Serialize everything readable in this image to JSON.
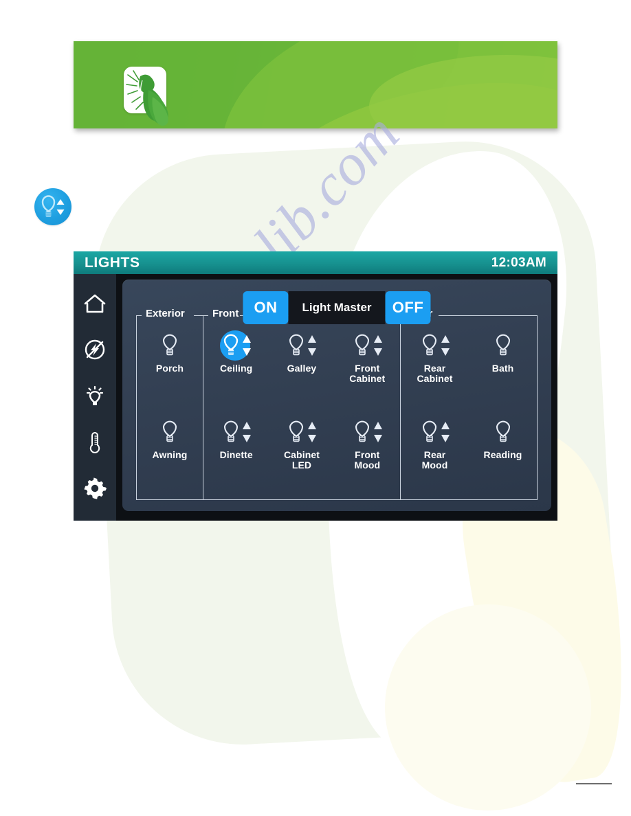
{
  "document": {
    "watermark": "manualslib.com"
  },
  "banner": {
    "logo_icon": "grasshopper-logo-icon",
    "accent_green": "#8cc63f",
    "accent_green_dark": "#4fa832"
  },
  "section_badge": {
    "icon": "dimmable-light-bulb-icon",
    "color": "#1f9fe0"
  },
  "device": {
    "titlebar": {
      "title": "LIGHTS",
      "clock": "12:03AM",
      "color": "#17918f"
    },
    "sidebar": {
      "items": [
        {
          "icon": "home-icon",
          "name": "sidebar-item-home"
        },
        {
          "icon": "power-off-icon",
          "name": "sidebar-item-power"
        },
        {
          "icon": "light-bulb-icon",
          "name": "sidebar-item-lights"
        },
        {
          "icon": "thermometer-icon",
          "name": "sidebar-item-climate"
        },
        {
          "icon": "gear-icon",
          "name": "sidebar-item-settings"
        }
      ]
    },
    "master": {
      "on_label": "ON",
      "label": "Light Master",
      "off_label": "OFF",
      "button_color": "#1b9ef2"
    },
    "groups": [
      {
        "legend": "Exterior",
        "rows": [
          [
            {
              "label": "Porch",
              "dimmable": false,
              "active": false
            }
          ],
          [
            {
              "label": "Awning",
              "dimmable": false,
              "active": false
            }
          ]
        ]
      },
      {
        "legend": "Front",
        "rows": [
          [
            {
              "label": "Ceiling",
              "dimmable": true,
              "active": true
            },
            {
              "label": "Galley",
              "dimmable": true,
              "active": false
            },
            {
              "label": "Front\nCabinet",
              "dimmable": true,
              "active": false
            }
          ],
          [
            {
              "label": "Dinette",
              "dimmable": true,
              "active": false
            },
            {
              "label": "Cabinet\nLED",
              "dimmable": true,
              "active": false
            },
            {
              "label": "Front\nMood",
              "dimmable": true,
              "active": false
            }
          ]
        ]
      },
      {
        "legend": "Rear",
        "rows": [
          [
            {
              "label": "Rear\nCabinet",
              "dimmable": true,
              "active": false
            },
            {
              "label": "Bath",
              "dimmable": false,
              "active": false
            }
          ],
          [
            {
              "label": "Rear\nMood",
              "dimmable": true,
              "active": false
            },
            {
              "label": "Reading",
              "dimmable": false,
              "active": false
            }
          ]
        ]
      }
    ]
  }
}
